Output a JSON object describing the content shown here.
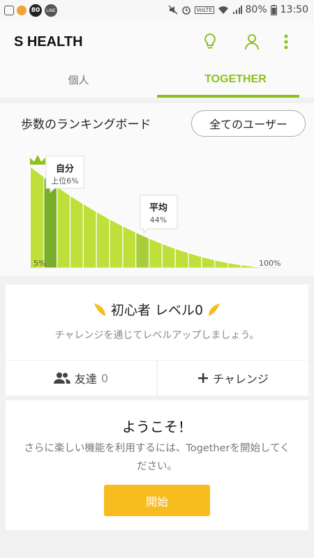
{
  "status_bar": {
    "badge": "80",
    "line_label": "LINE",
    "volte": "VoLTE",
    "battery": "80%",
    "time": "13:50"
  },
  "app_bar": {
    "title": "S HEALTH"
  },
  "tabs": [
    {
      "label": "個人",
      "active": false
    },
    {
      "label": "TOGETHER",
      "active": true
    }
  ],
  "ranking": {
    "title": "歩数のランキングボード",
    "filter_label": "全てのユーザー",
    "me": {
      "title": "自分",
      "detail": "上位6%"
    },
    "average": {
      "title": "平均",
      "detail": "44%"
    },
    "start_label": "5%",
    "end_label": "100%",
    "accent_color": "#bfe03a",
    "highlight_color": "#78ad2a"
  },
  "level": {
    "title": "初心者 レベル0",
    "subtitle": "チャレンジを通じてレベルアップしましょう。"
  },
  "friends": {
    "label": "友達",
    "count": "0"
  },
  "challenge": {
    "label": "チャレンジ"
  },
  "welcome": {
    "title": "ようこそ！",
    "body": "さらに楽しい機能を利用するには、Togetherを開始してください。",
    "button_label": "開始",
    "button_color": "#f7bc1d"
  }
}
